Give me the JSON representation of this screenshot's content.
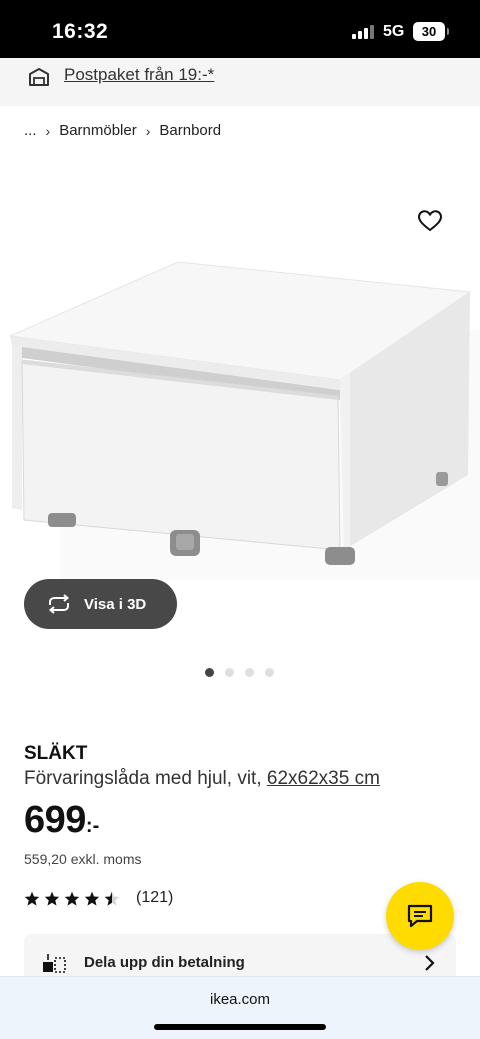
{
  "status_bar": {
    "time": "16:32",
    "network": "5G",
    "battery": "30"
  },
  "promo": {
    "text": "Postpaket från 19:-*",
    "icon": "package-icon"
  },
  "breadcrumb": {
    "ellipsis": "...",
    "items": [
      "Barnmöbler",
      "Barnbord"
    ]
  },
  "gallery": {
    "favorite_icon": "heart-icon",
    "view_3d_label": "Visa i 3D",
    "page_count": 4,
    "active_page": 1
  },
  "product": {
    "name": "SLÄKT",
    "description": "Förvaringslåda med hjul, vit,",
    "size": "62x62x35 cm",
    "price": "699",
    "price_suffix": ":-",
    "price_excl_vat": "559,20 exkl. moms",
    "rating": 4.5,
    "rating_count": "(121)"
  },
  "payment": {
    "label": "Dela upp din betalning",
    "icon": "split-payment-icon"
  },
  "chat": {
    "icon": "chat-icon"
  },
  "browser": {
    "url": "ikea.com"
  },
  "colors": {
    "chat_button": "#ffdb00",
    "view_3d_button": "#484848"
  }
}
